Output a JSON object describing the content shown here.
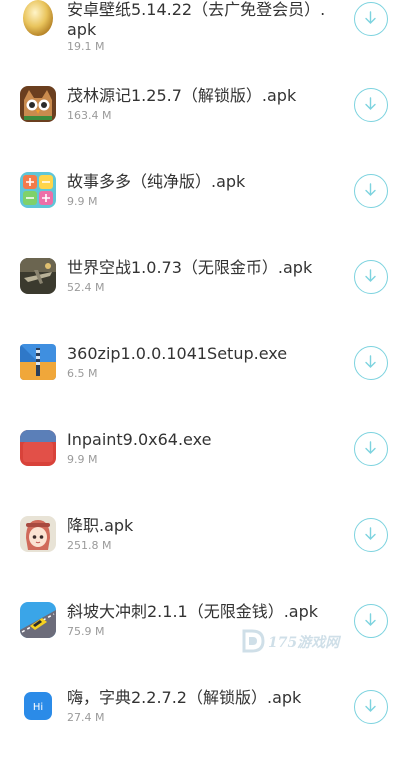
{
  "files": [
    {
      "name": "安卓壁纸5.14.22（去广免登会员）.apk",
      "size": "19.1 M",
      "icon": "egg-app-icon"
    },
    {
      "name": "茂林源记1.25.7（解锁版）.apk",
      "size": "163.4 M",
      "icon": "owl-app-icon"
    },
    {
      "name": "故事多多（纯净版）.apk",
      "size": "9.9 M",
      "icon": "story-app-icon"
    },
    {
      "name": "世界空战1.0.73（无限金币）.apk",
      "size": "52.4 M",
      "icon": "plane-app-icon"
    },
    {
      "name": "360zip1.0.0.1041Setup.exe",
      "size": "6.5 M",
      "icon": "zip-app-icon"
    },
    {
      "name": "Inpaint9.0x64.exe",
      "size": "9.9 M",
      "icon": "inpaint-app-icon"
    },
    {
      "name": "降职.apk",
      "size": "251.8 M",
      "icon": "anime-girl-app-icon"
    },
    {
      "name": "斜坡大冲刺2.1.1（无限金钱）.apk",
      "size": "75.9 M",
      "icon": "car-app-icon"
    },
    {
      "name": "嗨，字典2.2.7.2（解锁版）.apk",
      "size": "27.4 M",
      "icon": "dictionary-app-icon"
    }
  ],
  "download_icon": "download-icon",
  "watermark": {
    "text": "175游戏网",
    "logo": "d-logo-icon"
  },
  "colors": {
    "download_ring": "#7dd3df",
    "name_text": "#333333",
    "size_text": "#9a9a9a"
  }
}
